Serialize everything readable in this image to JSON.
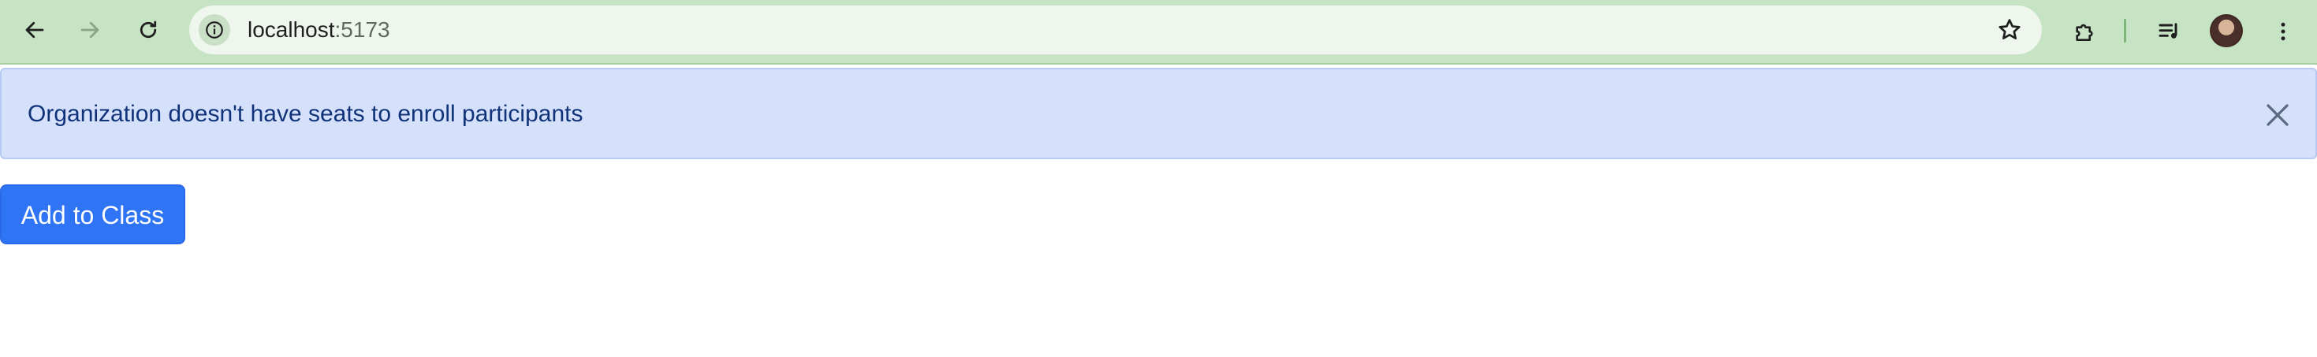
{
  "browser": {
    "url_host": "localhost",
    "url_port": ":5173",
    "icons": {
      "back": "arrow-left-icon",
      "forward": "arrow-right-icon",
      "reload": "reload-icon",
      "site_info": "info-icon",
      "bookmark": "star-icon",
      "extensions": "puzzle-icon",
      "media": "media-queue-icon",
      "profile": "avatar",
      "menu": "kebab-menu-icon"
    },
    "colors": {
      "toolbar": "#c6e3c3",
      "omnibox": "#eff6ee"
    }
  },
  "alert": {
    "message": "Organization doesn't have seats to enroll participants",
    "close_icon": "close-icon",
    "colors": {
      "background": "#d5e0fb",
      "border": "#b7c9f4",
      "text": "#0f3279"
    }
  },
  "actions": {
    "add_to_class_label": "Add to Class",
    "colors": {
      "primary": "#2f74f5"
    }
  }
}
